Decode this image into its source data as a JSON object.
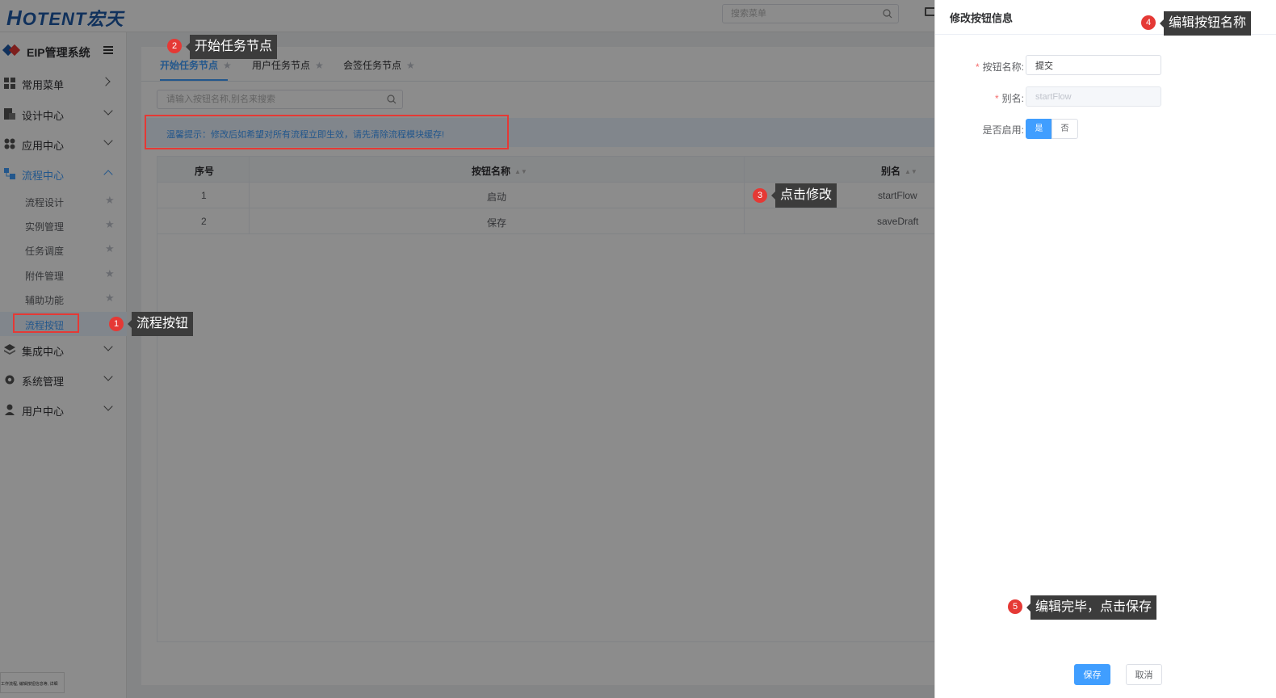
{
  "header": {
    "logo_text": "OTENT宏天",
    "logo_initial": "H",
    "search_placeholder": "搜索菜单"
  },
  "sidebar": {
    "system_name": "EIP管理系统",
    "menus": [
      {
        "label": "常用菜单"
      },
      {
        "label": "设计中心"
      },
      {
        "label": "应用中心"
      },
      {
        "label": "流程中心"
      },
      {
        "label": "集成中心"
      },
      {
        "label": "系统管理"
      },
      {
        "label": "用户中心"
      }
    ],
    "flow_sub": [
      {
        "label": "流程设计"
      },
      {
        "label": "实例管理"
      },
      {
        "label": "任务调度"
      },
      {
        "label": "附件管理"
      },
      {
        "label": "辅助功能"
      },
      {
        "label": "流程按钮"
      }
    ]
  },
  "main": {
    "tabs": [
      {
        "label": "开始任务节点"
      },
      {
        "label": "用户任务节点"
      },
      {
        "label": "会签任务节点"
      }
    ],
    "search_placeholder": "请输入按钮名称,别名来搜索",
    "tip": "温馨提示：修改后如希望对所有流程立即生效，请先清除流程模块缓存!",
    "table": {
      "headers": {
        "index": "序号",
        "name": "按钮名称",
        "alias": "别名"
      },
      "rows": [
        {
          "index": "1",
          "name": "启动",
          "alias": "startFlow"
        },
        {
          "index": "2",
          "name": "保存",
          "alias": "saveDraft"
        }
      ]
    }
  },
  "thumbnail_text": "工作流程, 编辑按钮信息等, 详细",
  "drawer": {
    "title": "修改按钮信息",
    "fields": {
      "name_label": "按钮名称:",
      "name_value": "提交",
      "alias_label": "别名:",
      "alias_value": "startFlow",
      "enabled_label": "是否启用:",
      "enabled_yes": "是",
      "enabled_no": "否"
    },
    "save_label": "保存",
    "cancel_label": "取消"
  },
  "annotations": [
    {
      "number": "1",
      "text": "流程按钮"
    },
    {
      "number": "2",
      "text": "开始任务节点"
    },
    {
      "number": "3",
      "text": "点击修改"
    },
    {
      "number": "4",
      "text": "编辑按钮名称"
    },
    {
      "number": "5",
      "text": "编辑完毕，点击保存"
    }
  ],
  "colors": {
    "primary": "#409eff",
    "annotation_red": "#e53935",
    "callout_bg": "#3c3c3c"
  }
}
